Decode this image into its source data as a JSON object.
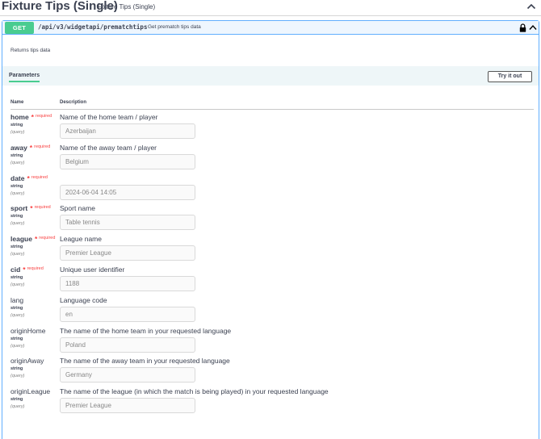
{
  "tag": {
    "title": "Fixture Tips (Single)",
    "description": "Fixture Tips (Single)"
  },
  "operation": {
    "method": "GET",
    "path": "/api/v3/widgetapi/prematchtips",
    "summary": "Get prematch tips data",
    "description": "Returns tips data"
  },
  "parameters_section": {
    "tab_label": "Parameters",
    "try_button": "Try it out",
    "col_name": "Name",
    "col_description": "Description"
  },
  "colors": {
    "get_method": "#49cc90",
    "get_border": "#61affe",
    "required": "#f93e3e"
  },
  "icons": {
    "tag_toggle": "chevron-up-icon",
    "lock": "lock-icon",
    "op_toggle": "chevron-up-icon"
  },
  "params": [
    {
      "name": "home",
      "required_mark": "*",
      "required_label": "required",
      "type": "string",
      "in": "(query)",
      "description": "Name of the home team / player",
      "value": "Azerbaijan"
    },
    {
      "name": "away",
      "required_mark": "*",
      "required_label": "required",
      "type": "string",
      "in": "(query)",
      "description": "Name of the away team / player",
      "value": "Belgium"
    },
    {
      "name": "date",
      "required_mark": "*",
      "required_label": "required",
      "type": "string",
      "in": "(query)",
      "description": "",
      "value": "2024-06-04 14:05"
    },
    {
      "name": "sport",
      "required_mark": "*",
      "required_label": "required",
      "type": "string",
      "in": "(query)",
      "description": "Sport name",
      "value": "Table tennis"
    },
    {
      "name": "league",
      "required_mark": "*",
      "required_label": "required",
      "type": "string",
      "in": "(query)",
      "description": "League name",
      "value": "Premier League"
    },
    {
      "name": "cid",
      "required_mark": "*",
      "required_label": "required",
      "type": "string",
      "in": "(query)",
      "description": "Unique user identifier",
      "value": "1188"
    },
    {
      "name": "lang",
      "type": "string",
      "in": "(query)",
      "description": "Language code",
      "value": "en"
    },
    {
      "name": "originHome",
      "type": "string",
      "in": "(query)",
      "description": "The name of the home team in your requested language",
      "value": "Poland"
    },
    {
      "name": "originAway",
      "type": "string",
      "in": "(query)",
      "description": "The name of the away team in your requested language",
      "value": "Germany"
    },
    {
      "name": "originLeague",
      "type": "string",
      "in": "(query)",
      "description": "The name of the league (in which the match is being played) in your requested language",
      "value": "Premier League"
    }
  ]
}
